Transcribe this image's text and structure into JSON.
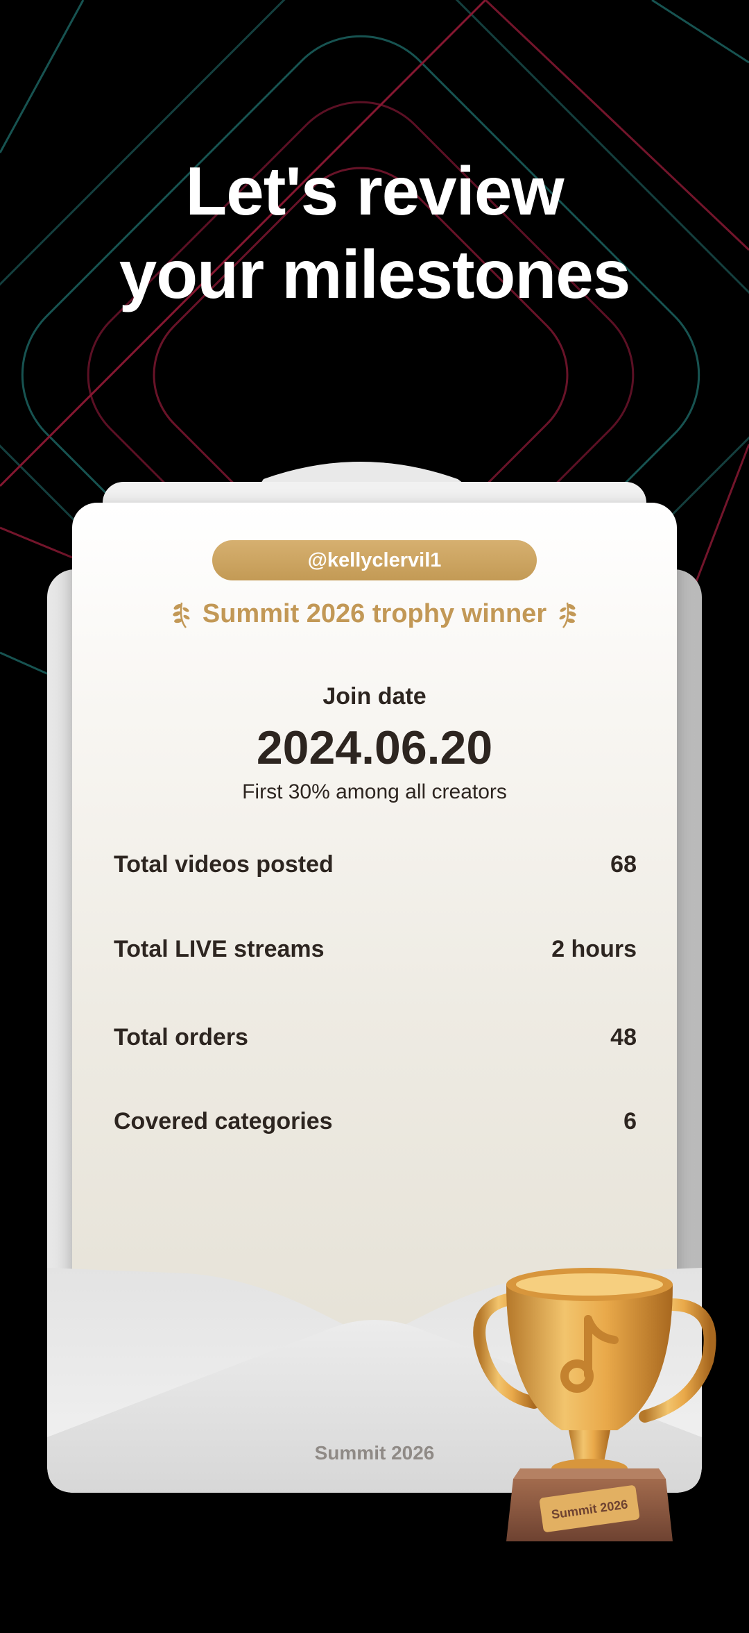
{
  "headline": {
    "line1": "Let's review",
    "line2": "your milestones"
  },
  "card": {
    "handle": "@kellyclervil1",
    "trophy_title": "Summit 2026 trophy winner",
    "join_label": "Join date",
    "join_date": "2024.06.20",
    "join_sub": "First 30% among all creators",
    "stats": [
      {
        "label": "Total videos posted",
        "value": "68"
      },
      {
        "label": "Total LIVE streams",
        "value": "2 hours"
      },
      {
        "label": "Total orders",
        "value": "48"
      },
      {
        "label": "Covered categories",
        "value": "6"
      }
    ],
    "footer": "Summit 2026"
  },
  "trophy": {
    "plaque_text": "Summit 2026",
    "icon": "tiktok-note-icon"
  },
  "colors": {
    "background": "#000000",
    "gold": "#c29856",
    "line_red": "#e3264d",
    "line_teal": "#38c9c4",
    "text_dark": "#2d2520"
  }
}
